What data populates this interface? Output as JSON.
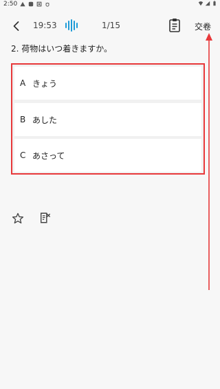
{
  "statusbar": {
    "time": "2:50",
    "left_icons": [
      "warning-icon",
      "app-icon",
      "notification-icon",
      "bug-icon"
    ],
    "right_icons": [
      "wifi-icon",
      "signal-icon",
      "battery-icon"
    ]
  },
  "toolbar": {
    "back_icon": "chevron-left-icon",
    "timer": "19:53",
    "audio_icon": "sound-wave-icon",
    "progress": "1/15",
    "answer_sheet_icon": "clipboard-icon",
    "submit_label": "交卷"
  },
  "question": {
    "text": "2. 荷物はいつ着きますか。"
  },
  "options": [
    {
      "letter": "A",
      "text": "きょう"
    },
    {
      "letter": "B",
      "text": "あした"
    },
    {
      "letter": "C",
      "text": "あさって"
    }
  ],
  "bottom_actions": {
    "favorite_icon": "star-icon",
    "note_icon": "note-edit-icon"
  },
  "colors": {
    "accent": "#1e9bd7",
    "annotation": "#e8383a",
    "background": "#f7f7f7"
  }
}
